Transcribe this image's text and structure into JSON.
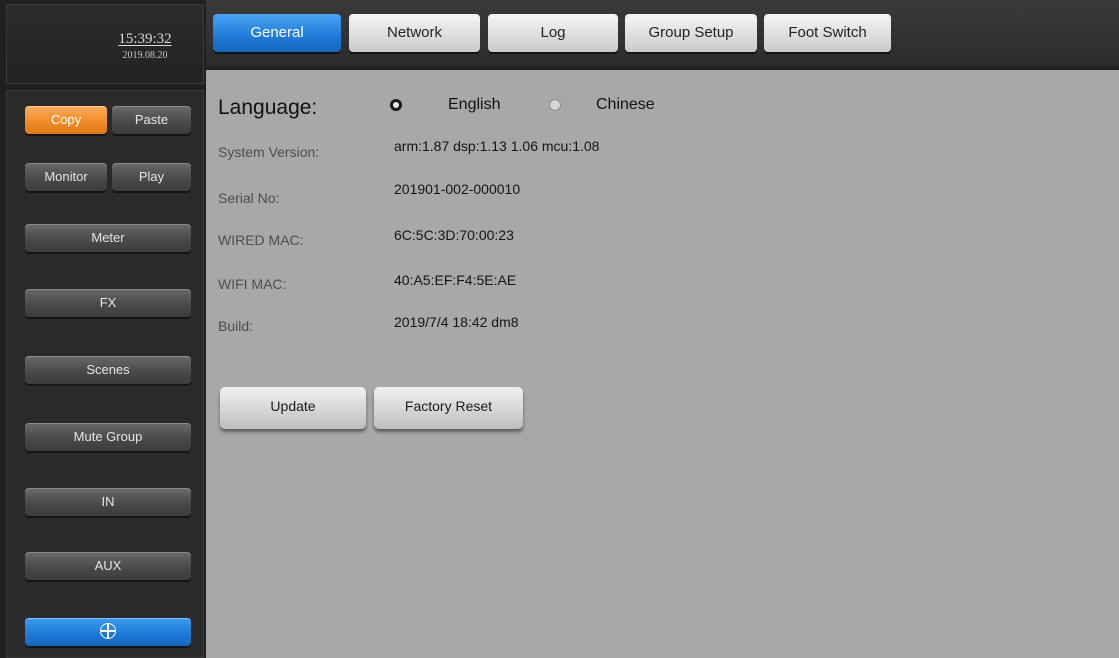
{
  "clock": {
    "time": "15:39:32",
    "date": "2019.08.20"
  },
  "sidebar": {
    "copy_label": "Copy",
    "paste_label": "Paste",
    "monitor_label": "Monitor",
    "play_label": "Play",
    "items": [
      {
        "label": "Meter"
      },
      {
        "label": "FX"
      },
      {
        "label": "Scenes"
      },
      {
        "label": "Mute Group"
      },
      {
        "label": "IN"
      },
      {
        "label": "AUX"
      }
    ],
    "network_icon": "globe-icon"
  },
  "tabs": [
    {
      "label": "General",
      "active": true
    },
    {
      "label": "Network",
      "active": false
    },
    {
      "label": "Log",
      "active": false
    },
    {
      "label": "Group Setup",
      "active": false
    },
    {
      "label": "Foot Switch",
      "active": false
    }
  ],
  "general": {
    "language_label": "Language:",
    "language_options": [
      {
        "label": "English",
        "selected": true
      },
      {
        "label": "Chinese",
        "selected": false
      }
    ],
    "info": [
      {
        "label": "System Version:",
        "value": "arm:1.87 dsp:1.13 1.06 mcu:1.08"
      },
      {
        "label": "Serial No:",
        "value": "201901-002-000010"
      },
      {
        "label": "WIRED MAC:",
        "value": "6C:5C:3D:70:00:23"
      },
      {
        "label": "WIFI MAC:",
        "value": "40:A5:EF:F4:5E:AE"
      },
      {
        "label": "Build:",
        "value": "2019/7/4 18:42 dm8"
      }
    ],
    "update_label": "Update",
    "factory_reset_label": "Factory Reset"
  },
  "colors": {
    "accent_orange": "#f08a25",
    "accent_blue": "#1e7ad8",
    "panel_gray": "#a7a8a7"
  }
}
